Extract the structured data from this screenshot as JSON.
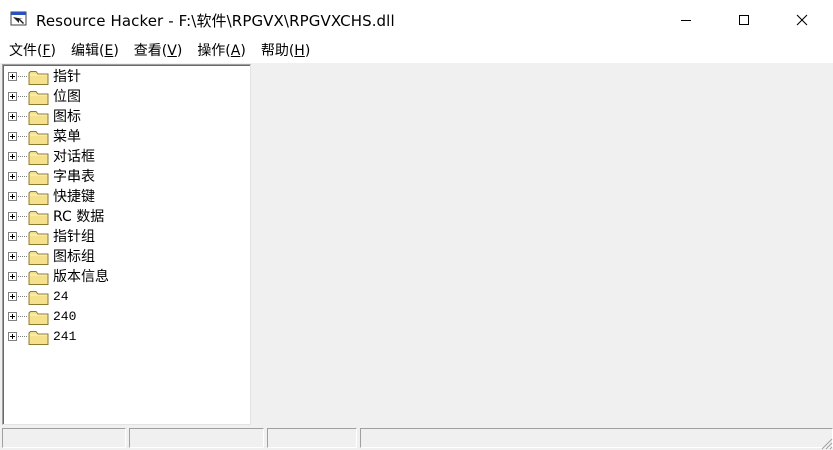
{
  "window": {
    "title": "Resource Hacker  -  F:\\软件\\RPGVX\\RPGVXCHS.dll",
    "app_icon": "resource-hacker-app-icon",
    "controls": {
      "minimize": "minimize-icon",
      "maximize": "maximize-icon",
      "close": "close-icon"
    }
  },
  "menu": {
    "items": [
      {
        "label": "文件(",
        "key": "F",
        "close": ")"
      },
      {
        "label": "编辑(",
        "key": "E",
        "close": ")"
      },
      {
        "label": "查看(",
        "key": "V",
        "close": ")"
      },
      {
        "label": "操作(",
        "key": "A",
        "close": ")"
      },
      {
        "label": "帮助(",
        "key": "H",
        "close": ")"
      }
    ]
  },
  "tree": {
    "items": [
      {
        "label": "指针"
      },
      {
        "label": "位图"
      },
      {
        "label": "图标"
      },
      {
        "label": "菜单"
      },
      {
        "label": "对话框"
      },
      {
        "label": "字串表"
      },
      {
        "label": "快捷键"
      },
      {
        "label": "RC 数据"
      },
      {
        "label": "指针组"
      },
      {
        "label": "图标组"
      },
      {
        "label": "版本信息"
      },
      {
        "label": "24"
      },
      {
        "label": "240"
      },
      {
        "label": "241"
      }
    ]
  },
  "statusbar": {
    "cells": [
      "",
      "",
      "",
      ""
    ]
  },
  "colors": {
    "folder_fill": "#f5e08b",
    "folder_border": "#8c7a2e",
    "panel_background": "#f0f0f0"
  }
}
